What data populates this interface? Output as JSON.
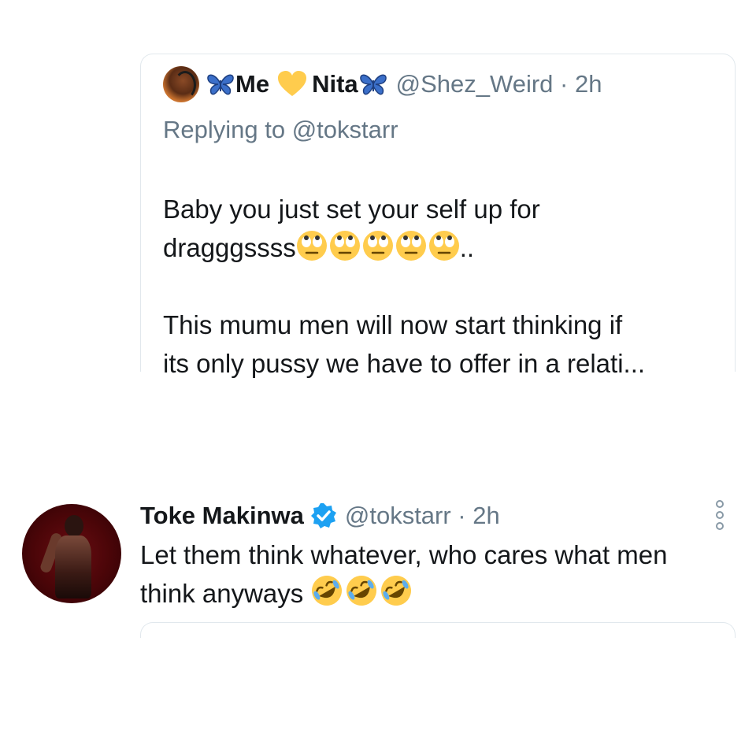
{
  "quoted_tweet": {
    "display_name_part1": "Me",
    "display_name_part2": "Nita",
    "handle_time": "@Shez_Weird · 2h",
    "replying_to": "Replying to @tokstarr",
    "body_line1": "Baby you just set your self up for",
    "body_line2_text": "dragggssss",
    "body_line2_suffix": "..",
    "body_line3": "This mumu men will now start thinking if",
    "body_line4": "its only pussy we have to offer in a relati...",
    "icons": [
      "butterfly-icon",
      "yellow-heart-icon",
      "butterfly-icon",
      "face-with-rolling-eyes-icon"
    ]
  },
  "reply_tweet": {
    "name": "Toke Makinwa",
    "handle_time": "@tokstarr · 2h",
    "body_line1": "Let them think whatever, who cares what men",
    "body_line2": "think anyways",
    "icons": [
      "verified-badge-icon",
      "rolling-on-the-floor-laughing-icon",
      "more-options-icon"
    ]
  },
  "colors": {
    "text_primary": "#14171a",
    "text_secondary": "#657786",
    "border": "#e1e8ed",
    "verified_blue": "#1da1f2",
    "butterfly_blue": "#3b6fc9",
    "heart_yellow": "#ffcc4d"
  }
}
